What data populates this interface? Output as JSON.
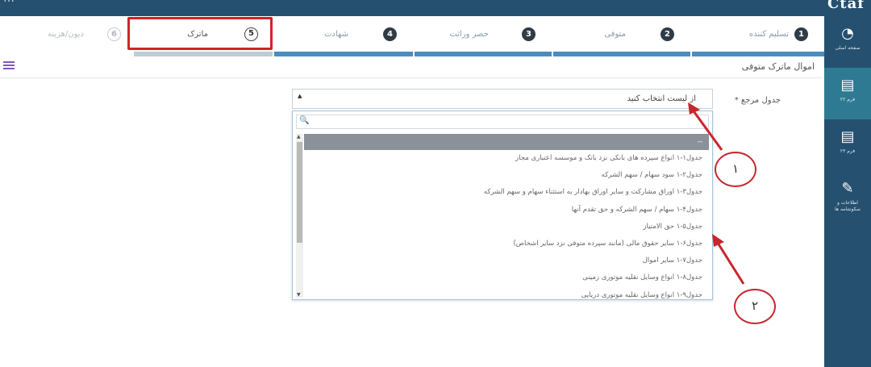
{
  "topbar": {
    "logo": "Ctaf",
    "logo_left": "…"
  },
  "sidebar": {
    "items": [
      {
        "icon": "dashboard-icon",
        "glyph": "◔",
        "label": "صفحه اصلی"
      },
      {
        "icon": "document-icon",
        "glyph": "▤",
        "label": "فرم ۲۲"
      },
      {
        "icon": "document-icon",
        "glyph": "▤",
        "label": "فرم ۲۳"
      },
      {
        "icon": "tag-icon",
        "glyph": "✎",
        "label": "اطلاعات و سکونتنامه ها"
      }
    ]
  },
  "steps": [
    {
      "num": "1",
      "label": "تسلیم کننده"
    },
    {
      "num": "2",
      "label": "متوفی"
    },
    {
      "num": "3",
      "label": "حصر وراثت"
    },
    {
      "num": "4",
      "label": "شهادت"
    },
    {
      "num": "5",
      "label": "ماترک"
    },
    {
      "num": "6",
      "label": "دیون/هزینه"
    }
  ],
  "section": {
    "title": "اموال ماترک متوفی"
  },
  "field": {
    "label": "جدول مرجع *"
  },
  "select": {
    "value": "از لیست انتخاب کنید",
    "caret": "▲"
  },
  "dropdown": {
    "search_icon": "🔍",
    "options": [
      "--",
      "جدول۱-۱ انواع سپرده های بانکی نزد بانک و موسسه اعتباری مجاز",
      "جدول۲-۱ سود سهام / سهم الشرکه",
      "جدول۳-۱ اوراق مشارکت و سایر اوراق بهادار به استثناء سهام و سهم الشرکه",
      "جدول۴-۱ سهام / سهم الشرکه و حق تقدم آنها",
      "جدول۵-۱ حق الامتیاز",
      "جدول۶-۱ سایر حقوق مالی (مانند سپرده متوفی نزد سایر اشخاص)",
      "جدول۷-۱ سایر اموال",
      "جدول۸-۱ انواع وسایل نقلیه موتوری زمینی",
      "جدول۹-۱ انواع وسایل نقلیه موتوری دریایی"
    ]
  },
  "annotations": {
    "one": "١",
    "two": "٢"
  },
  "colors": {
    "sidebar": "#25506f",
    "active": "#2e7a93",
    "step_bar": "#4a8dbf",
    "highlight": "#d0232b"
  }
}
